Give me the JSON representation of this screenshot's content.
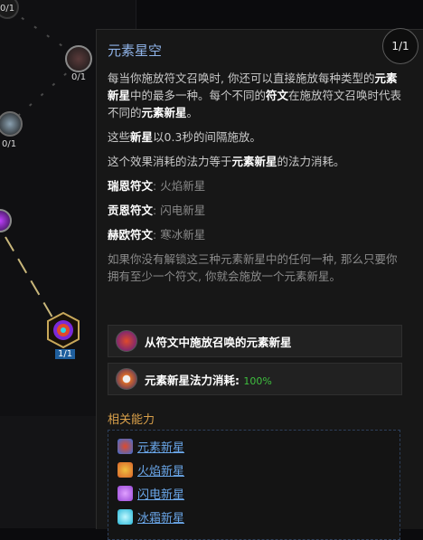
{
  "tree": {
    "nodes": [
      {
        "label": "0/1"
      },
      {
        "label": "0/1"
      },
      {
        "label": "0/1"
      },
      {
        "label": "1/1"
      }
    ]
  },
  "tooltip": {
    "title": "元素星空",
    "rank": "1/1",
    "para1_a": "每当你施放符文召唤时, 你还可以直接施放每种类型的",
    "para1_b": "元素新星",
    "para1_c": "中的最多一种。每个不同的",
    "para1_d": "符文",
    "para1_e": "在施放符文召唤时代表不同的",
    "para1_f": "元素新星",
    "para1_g": "。",
    "para2_a": "这些",
    "para2_b": "新星",
    "para2_c": "以0.3秒的间隔施放。",
    "para3_a": "这个效果消耗的法力等于",
    "para3_b": "元素新星",
    "para3_c": "的法力消耗。",
    "runes": [
      {
        "name": "瑞恩符文",
        "sep": ": ",
        "effect": "火焰新星"
      },
      {
        "name": "贡恩符文",
        "sep": ": ",
        "effect": "闪电新星"
      },
      {
        "name": "赫欧符文",
        "sep": ": ",
        "effect": "寒冰新星"
      }
    ],
    "para4": "如果你没有解锁这三种元素新星中的任何一种, 那么只要你拥有至少一个符文, 你就会施放一个元素新星。",
    "effect1": "从符文中施放召唤的元素新星",
    "effect2_label": "元素新星法力消耗: ",
    "effect2_value": "100%",
    "related_title": "相关能力",
    "related": [
      {
        "label": "元素新星",
        "color": "#3a6fd8"
      },
      {
        "label": "火焰新星",
        "color": "#d8632a"
      },
      {
        "label": "闪电新星",
        "color": "#9a4ad8"
      },
      {
        "label": "冰霜新星",
        "color": "#2ab8d8"
      }
    ]
  }
}
